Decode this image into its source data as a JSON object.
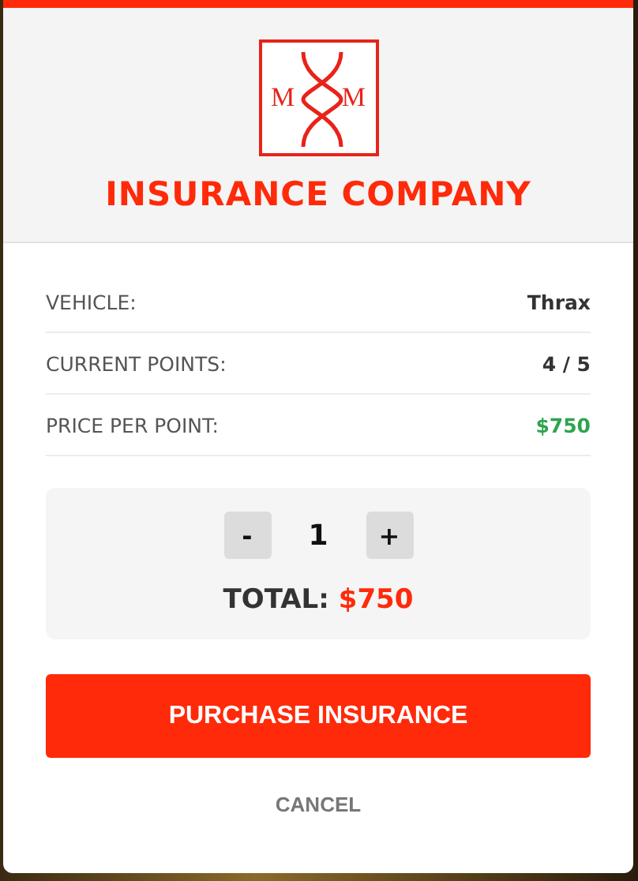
{
  "logo": {
    "letters": [
      "M",
      "M"
    ]
  },
  "title": "INSURANCE COMPANY",
  "rows": [
    {
      "label": "VEHICLE:",
      "value": "Thrax",
      "color": "#333333"
    },
    {
      "label": "CURRENT POINTS:",
      "value": "4 / 5",
      "color": "#333333"
    },
    {
      "label": "PRICE PER POINT:",
      "value": "$750",
      "color": "#2ea44f"
    }
  ],
  "quantity": {
    "minus": "-",
    "value": "1",
    "plus": "+"
  },
  "total": {
    "label": "TOTAL:",
    "value": "$750"
  },
  "buttons": {
    "purchase": "PURCHASE INSURANCE",
    "cancel": "CANCEL"
  }
}
